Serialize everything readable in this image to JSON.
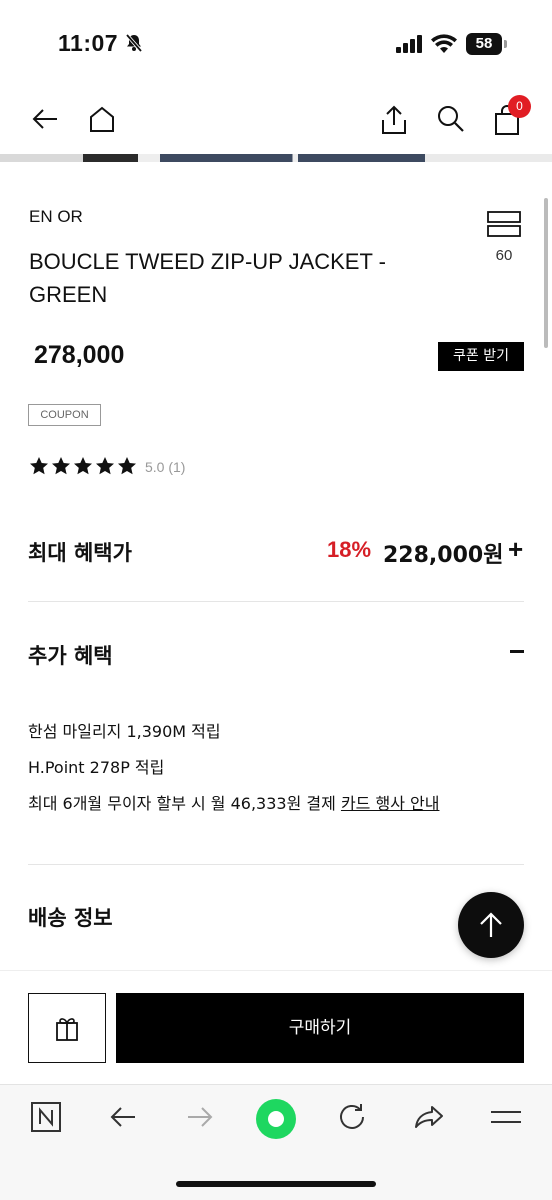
{
  "status": {
    "time": "11:07",
    "battery": "58"
  },
  "header": {
    "cart_count": "0"
  },
  "product": {
    "brand": "EN OR",
    "title": "BOUCLE TWEED ZIP-UP JACKET - GREEN",
    "size_count": "60",
    "price": "278,000",
    "coupon_button": "쿠폰 받기",
    "coupon_tag": "COUPON",
    "rating": "5.0 (1)",
    "stars": 5
  },
  "benefit": {
    "label": "최대 혜택가",
    "discount": "18%",
    "price": "228,000원",
    "toggle": "+"
  },
  "extra": {
    "label": "추가 혜택",
    "lines": [
      "한섬 마일리지 1,390M 적립",
      "H.Point 278P 적립",
      "최대 6개월 무이자 할부 시 월 46,333원 결제"
    ],
    "card_link": "카드 행사 안내"
  },
  "shipping": {
    "label": "배송 정보"
  },
  "actions": {
    "buy": "구매하기"
  },
  "colors": {
    "accent_red": "#d61f26",
    "badge_red": "#e11d24",
    "toolbar_green": "#1ed760"
  }
}
